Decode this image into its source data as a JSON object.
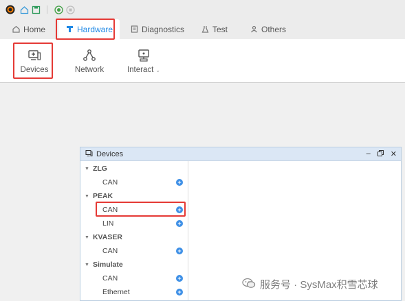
{
  "tabs": [
    {
      "label": "Home",
      "icon": "home-icon"
    },
    {
      "label": "Hardware",
      "icon": "hardware-icon"
    },
    {
      "label": "Diagnostics",
      "icon": "diagnostics-icon"
    },
    {
      "label": "Test",
      "icon": "flask-icon"
    },
    {
      "label": "Others",
      "icon": "user-icon"
    }
  ],
  "ribbon": {
    "devices_label": "Devices",
    "network_label": "Network",
    "interact_label": "Interact"
  },
  "panel": {
    "title": "Devices",
    "groups": [
      {
        "name": "ZLG",
        "items": [
          "CAN"
        ]
      },
      {
        "name": "PEAK",
        "items": [
          "CAN",
          "LIN"
        ]
      },
      {
        "name": "KVASER",
        "items": [
          "CAN"
        ]
      },
      {
        "name": "Simulate",
        "items": [
          "CAN",
          "Ethernet"
        ]
      }
    ]
  },
  "watermark": {
    "text": "服务号 · SysMax积雪芯球"
  },
  "colors": {
    "accent": "#1e88e5",
    "highlight": "#e53935",
    "add_button": "#3d8fe6"
  }
}
